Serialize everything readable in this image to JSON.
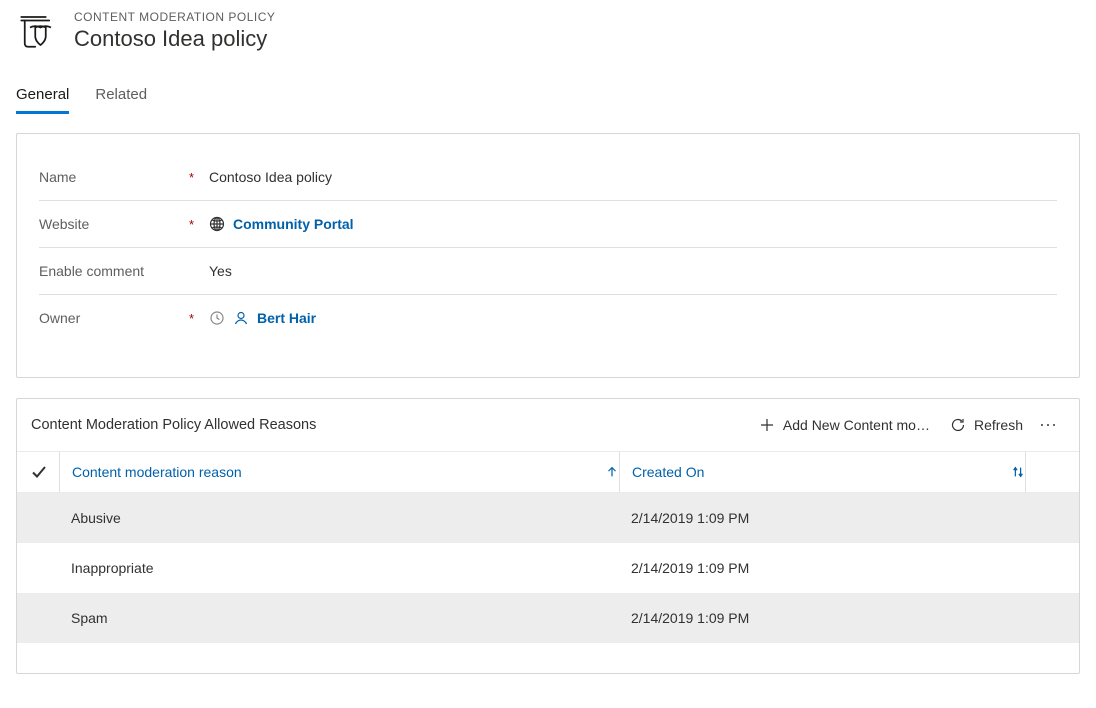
{
  "header": {
    "eyebrow": "CONTENT MODERATION POLICY",
    "title": "Contoso Idea policy"
  },
  "tabs": {
    "general": "General",
    "related": "Related"
  },
  "form": {
    "name_label": "Name",
    "name_value": "Contoso Idea policy",
    "website_label": "Website",
    "website_value": "Community Portal",
    "enable_comment_label": "Enable comment",
    "enable_comment_value": "Yes",
    "owner_label": "Owner",
    "owner_value": "Bert Hair"
  },
  "subgrid": {
    "title": "Content Moderation Policy Allowed Reasons",
    "add_label": "Add New Content mo…",
    "refresh_label": "Refresh",
    "col_reason": "Content moderation reason",
    "col_created": "Created On",
    "rows": [
      {
        "reason": "Abusive",
        "created": "2/14/2019 1:09 PM"
      },
      {
        "reason": "Inappropriate",
        "created": "2/14/2019 1:09 PM"
      },
      {
        "reason": "Spam",
        "created": "2/14/2019 1:09 PM"
      }
    ]
  }
}
